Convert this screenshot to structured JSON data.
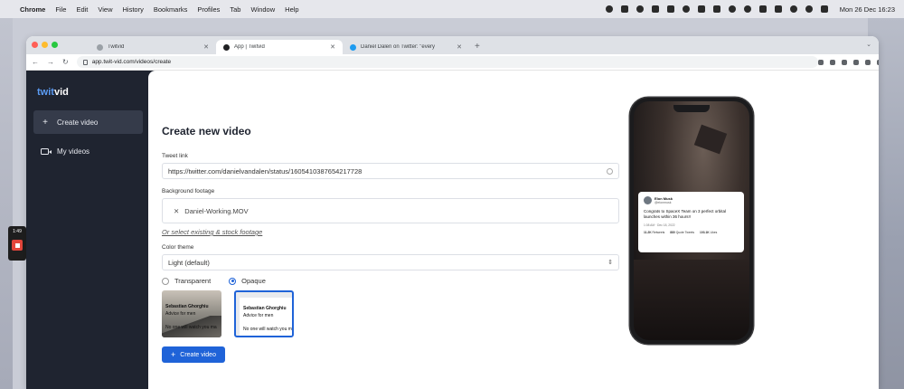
{
  "menubar": {
    "items": [
      "Chrome",
      "File",
      "Edit",
      "View",
      "History",
      "Bookmarks",
      "Profiles",
      "Tab",
      "Window",
      "Help"
    ],
    "clock": "Mon 26 Dec  16:23"
  },
  "recorder": {
    "time": "1:49"
  },
  "browser": {
    "tabs": [
      {
        "title": "Twitvid",
        "favicon": "twitvid-favicon"
      },
      {
        "title": "App | Twitvid",
        "favicon": "twitvid-dark-favicon"
      },
      {
        "title": "Daniel Dalen on Twitter: \"every",
        "favicon": "twitter-icon"
      }
    ],
    "url": "app.twit-vid.com/videos/create"
  },
  "app": {
    "logo": {
      "prefix": "twit",
      "suffix": "vid"
    },
    "nav": [
      {
        "label": "Create video",
        "icon": "plus-icon"
      },
      {
        "label": "My videos",
        "icon": "video-camera-icon"
      }
    ],
    "page_title": "Create new video",
    "form": {
      "tweet_link_label": "Tweet link",
      "tweet_link_value": "https://twitter.com/danielvandalen/status/1605410387654217728",
      "background_label": "Background footage",
      "background_file": "Daniel-Working.MOV",
      "select_existing_link": "Or select existing & stock footage",
      "color_theme_label": "Color theme",
      "color_theme_value": "Light (default)",
      "style_options": [
        {
          "label": "Transparent",
          "checked": false
        },
        {
          "label": "Opaque",
          "checked": true
        }
      ],
      "thumb_name": "Sebastian Ghorghiu",
      "thumb_name_opaque": "Sebastian Ghorghiu",
      "thumb_sub": "Advice for men",
      "thumb_body": "No one will watch you ma",
      "submit_label": "Create video"
    },
    "preview": {
      "tweet": {
        "name": "Elon Musk",
        "handle": "@elonmusk",
        "text": "Congrats to SpaceX Team on 3 perfect orbital launches within 36 hours!!",
        "meta": "1:08 AM · Dec 18, 2022",
        "stats": [
          {
            "count": "11.2K",
            "label": "Retweets"
          },
          {
            "count": "880",
            "label": "Quote Tweets"
          },
          {
            "count": "103.1K",
            "label": "Likes"
          }
        ]
      }
    }
  },
  "colors": {
    "accent": "#1f63d8",
    "sidebar": "#1f2430",
    "logo_accent": "#5b9cf5"
  }
}
